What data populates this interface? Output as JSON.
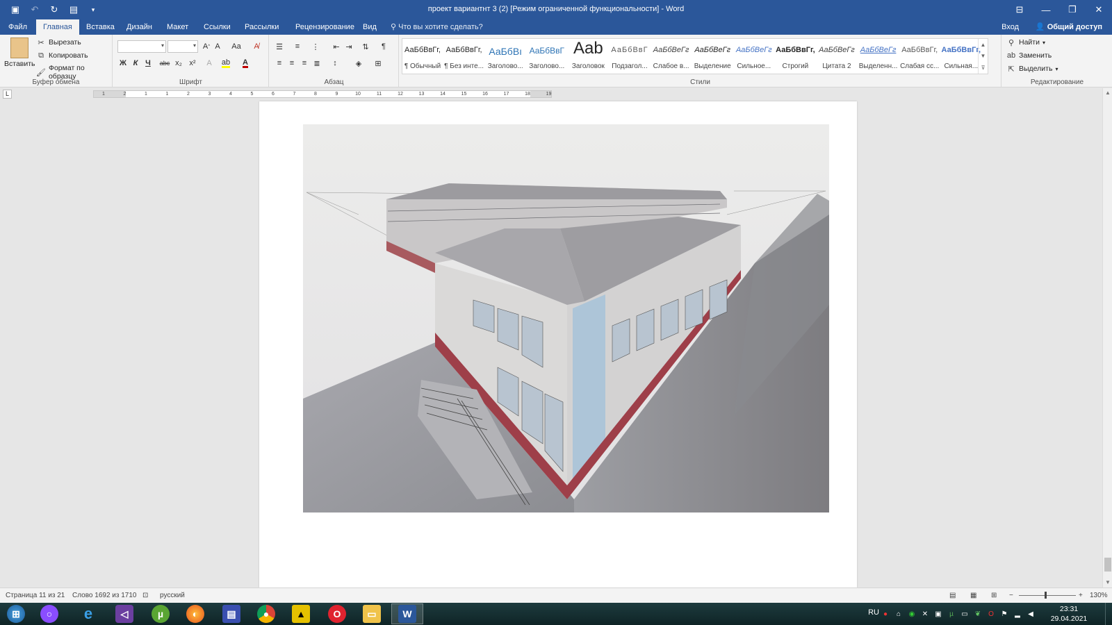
{
  "titlebar": {
    "title": "проект вариантнт 3 (2) [Режим ограниченной функциональности] - Word",
    "qat_icons": [
      "save-icon",
      "undo-icon",
      "redo-icon",
      "touch-mode-icon",
      "customize-icon"
    ],
    "window_controls": [
      "ribbon-display-icon",
      "minimize-icon",
      "restore-icon",
      "close-icon"
    ]
  },
  "tabs": {
    "items": [
      "Файл",
      "Главная",
      "Вставка",
      "Дизайн",
      "Макет",
      "Ссылки",
      "Рассылки",
      "Рецензирование",
      "Вид"
    ],
    "active": "Главная",
    "search_placeholder": "Что вы хотите сделать?",
    "signin": "Вход",
    "share": "Общий доступ"
  },
  "ribbon": {
    "clipboard": {
      "label": "Буфер обмена",
      "paste": "Вставить",
      "cut": "Вырезать",
      "copy": "Копировать",
      "format_painter": "Формат по образцу"
    },
    "font": {
      "label": "Шрифт",
      "font_name": "",
      "font_size": "",
      "bold": "Ж",
      "italic": "К",
      "underline": "Ч",
      "strike": "abc",
      "subscript": "x₂",
      "superscript": "x²",
      "case": "Aa",
      "grow": "A^",
      "shrink": "Aˇ",
      "font_color": "#c00000",
      "highlight_color": "#ffff00"
    },
    "paragraph": {
      "label": "Абзац"
    },
    "styles": {
      "label": "Стили",
      "items": [
        {
          "sample": "АаБбВвГг,",
          "name": "¶ Обычный"
        },
        {
          "sample": "АаБбВвГг,",
          "name": "¶ Без инте..."
        },
        {
          "sample": "АаБбВı",
          "name": "Заголово..."
        },
        {
          "sample": "АаБбВвГ",
          "name": "Заголово..."
        },
        {
          "sample": "Aab",
          "name": "Заголовок"
        },
        {
          "sample": "АаБбВвГ",
          "name": "Подзагол..."
        },
        {
          "sample": "АаБбВеГг",
          "name": "Слабое в..."
        },
        {
          "sample": "АаБбВеГг",
          "name": "Выделение"
        },
        {
          "sample": "АаБбВеГг",
          "name": "Сильное..."
        },
        {
          "sample": "АаБбВвГг,",
          "name": "Строгий"
        },
        {
          "sample": "АаБбВеГг",
          "name": "Цитата 2"
        },
        {
          "sample": "АаБбВеГг",
          "name": "Выделенн..."
        },
        {
          "sample": "АаБбВвГг,",
          "name": "Слабая сс..."
        },
        {
          "sample": "АаБбВвГг,",
          "name": "Сильная..."
        }
      ]
    },
    "editing": {
      "label": "Редактирование",
      "find": "Найти",
      "replace": "Заменить",
      "select": "Выделить"
    }
  },
  "ruler": {
    "corner": "L",
    "ticks": [
      "1",
      "2",
      "1",
      "1",
      "2",
      "3",
      "4",
      "5",
      "6",
      "7",
      "8",
      "9",
      "10",
      "11",
      "12",
      "13",
      "14",
      "15",
      "16",
      "17",
      "18",
      "19"
    ]
  },
  "document": {
    "image_icon": "watercolor-building-drawing"
  },
  "statusbar": {
    "page": "Страница 11 из 21",
    "words": "Слово 1692 из 1710",
    "language": "русский",
    "zoom": "130%",
    "zoom_minus": "−",
    "zoom_plus": "+"
  },
  "taskbar": {
    "apps": [
      "start-button",
      "alice-icon",
      "internet-explorer-icon",
      "visual-studio-icon",
      "utorrent-icon",
      "firefox-icon",
      "save-disk-icon",
      "chrome-icon",
      "batman-game-icon",
      "opera-icon",
      "file-explorer-icon",
      "word-icon"
    ],
    "active_app": "word-icon",
    "lang": "RU",
    "time": "23:31",
    "date": "29.04.2021"
  },
  "colors": {
    "word_blue": "#2b579a",
    "ribbon_bg": "#f3f3f3",
    "workspace_bg": "#e6e6e6"
  }
}
